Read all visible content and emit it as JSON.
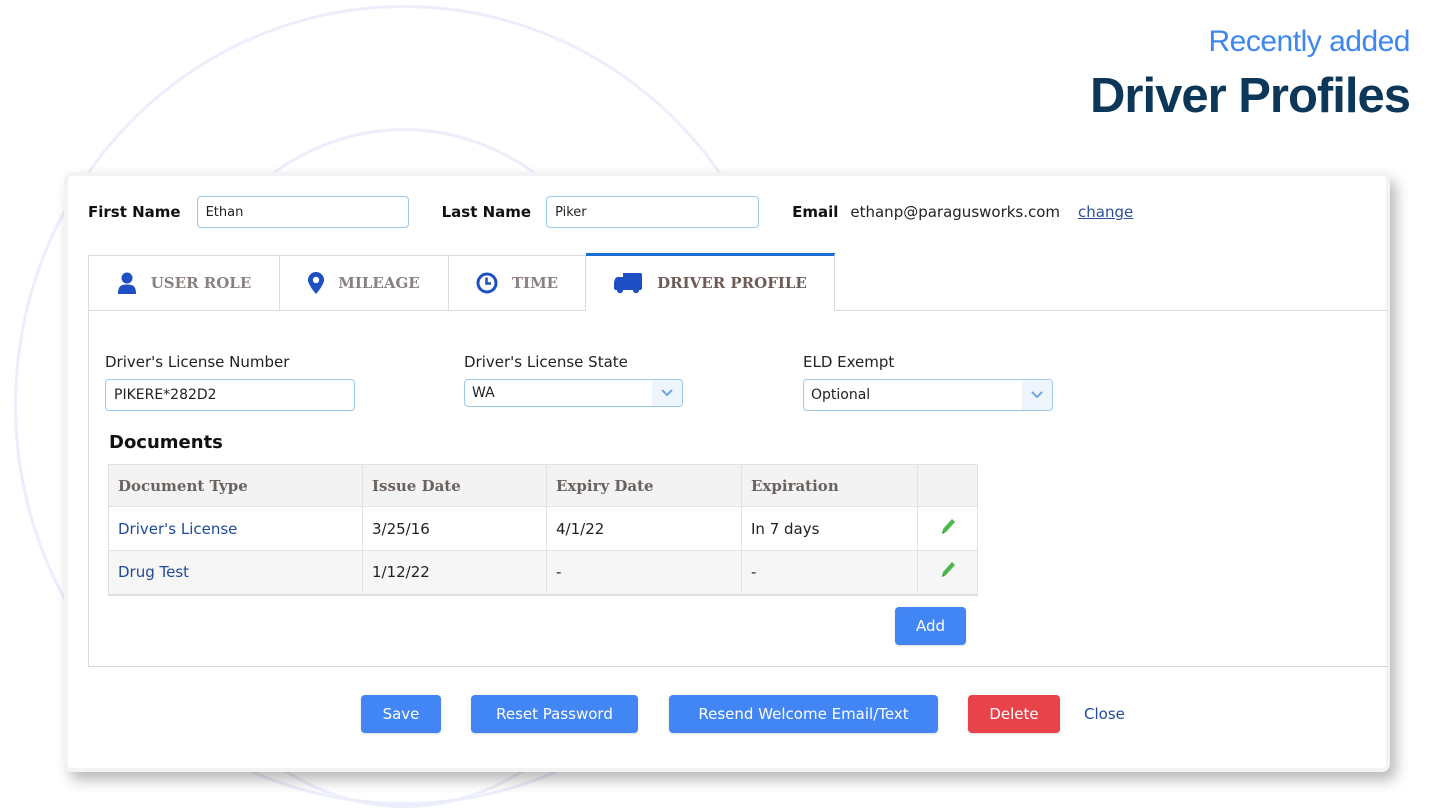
{
  "hero": {
    "kicker": "Recently added",
    "title": "Driver Profiles"
  },
  "user": {
    "first_name_label": "First Name",
    "first_name_value": "Ethan",
    "last_name_label": "Last Name",
    "last_name_value": "Piker",
    "email_label": "Email",
    "email_value": "ethanp@paragusworks.com",
    "change_link": "change"
  },
  "tabs": [
    {
      "label": "USER ROLE",
      "icon": "user-icon",
      "active": false
    },
    {
      "label": "MILEAGE",
      "icon": "map-pin-icon",
      "active": false
    },
    {
      "label": "TIME",
      "icon": "clock-icon",
      "active": false
    },
    {
      "label": "DRIVER PROFILE",
      "icon": "truck-icon",
      "active": true
    }
  ],
  "driver_profile": {
    "license_number_label": "Driver's License Number",
    "license_number_value": "PIKERE*282D2",
    "license_state_label": "Driver's License State",
    "license_state_value": "WA",
    "eld_label": "ELD Exempt",
    "eld_value": "Optional"
  },
  "documents": {
    "title": "Documents",
    "columns": [
      "Document Type",
      "Issue Date",
      "Expiry Date",
      "Expiration",
      ""
    ],
    "rows": [
      {
        "type": "Driver's License",
        "issue": "3/25/16",
        "expiry": "4/1/22",
        "expiration": "In 7 days"
      },
      {
        "type": "Drug Test",
        "issue": "1/12/22",
        "expiry": "-",
        "expiration": "-"
      }
    ],
    "add_label": "Add"
  },
  "actions": {
    "save": "Save",
    "reset_password": "Reset Password",
    "resend": "Resend Welcome Email/Text",
    "delete": "Delete",
    "close": "Close"
  },
  "colors": {
    "primary": "#4285f4",
    "danger": "#e8424a",
    "accent_tab": "#1a6dd1",
    "edit_icon": "#4cb84c",
    "hero_kicker": "#3d87f0",
    "hero_title": "#0d3759"
  }
}
